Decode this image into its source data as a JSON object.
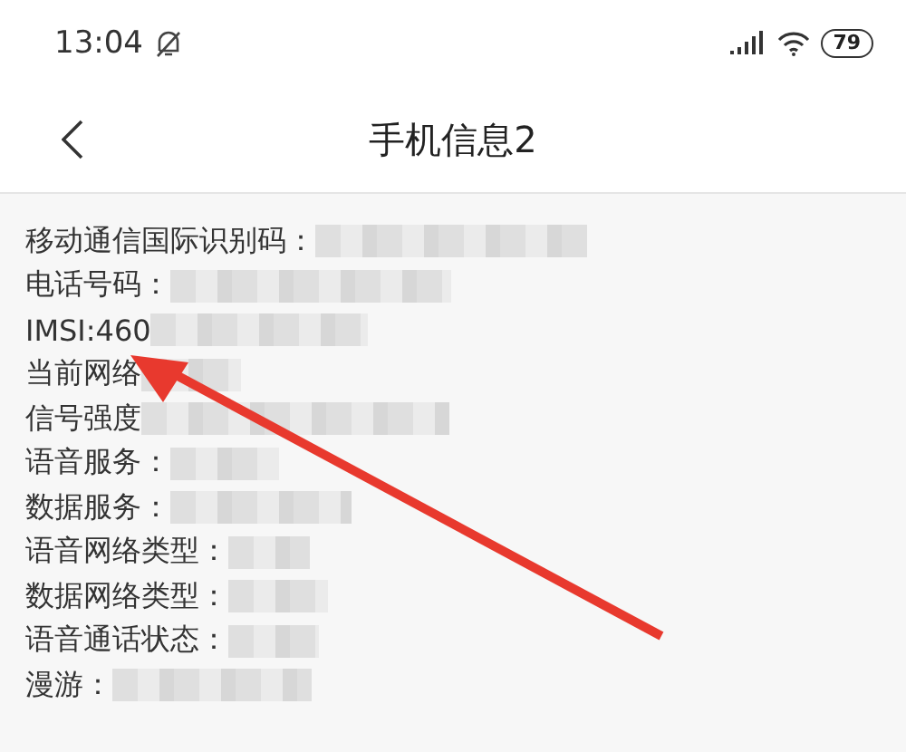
{
  "status_bar": {
    "time": "13:04",
    "battery": "79"
  },
  "header": {
    "title": "手机信息2"
  },
  "rows": [
    {
      "label": "移动通信国际识别码：",
      "redacted": true
    },
    {
      "label": "电话号码：",
      "redacted": true
    },
    {
      "label": "IMSI: ",
      "value": "460",
      "redacted": true
    },
    {
      "label": "当前网络",
      "redacted": true
    },
    {
      "label": "信号强度",
      "redacted": true
    },
    {
      "label": "语音服务：",
      "redacted": true
    },
    {
      "label": "数据服务：",
      "redacted": true
    },
    {
      "label": "语音网络类型：",
      "redacted": true
    },
    {
      "label": "数据网络类型：",
      "redacted": true
    },
    {
      "label": "语音通话状态：",
      "redacted": true
    },
    {
      "label": "漫游：",
      "redacted": true
    }
  ]
}
